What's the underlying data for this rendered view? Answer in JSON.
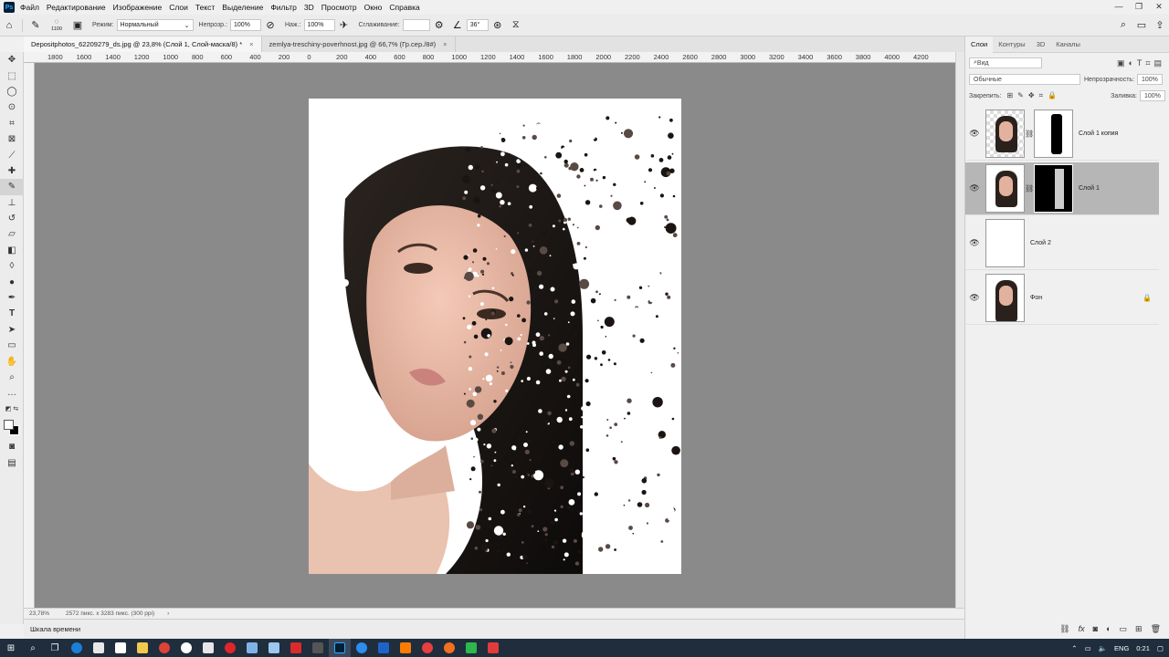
{
  "menu": {
    "items": [
      "Файл",
      "Редактирование",
      "Изображение",
      "Слои",
      "Текст",
      "Выделение",
      "Фильтр",
      "3D",
      "Просмотр",
      "Окно",
      "Справка"
    ]
  },
  "options": {
    "brush_size": "1100",
    "mode_label": "Режим:",
    "mode_value": "Нормальный",
    "opacity_label": "Непрозр.:",
    "opacity_value": "100%",
    "flow_label": "Наж.:",
    "flow_value": "100%",
    "smoothing_label": "Сглаживание:",
    "smoothing_value": "",
    "angle_value": "36°"
  },
  "tabs": [
    {
      "label": "Depositphotos_62209279_ds.jpg @ 23,8% (Слой 1, Слой-маска/8) *",
      "close": "×"
    },
    {
      "label": "zemlya-treschiny-poverhnost.jpg @ 66,7% (Гр.сер./8#)",
      "close": "×"
    }
  ],
  "ruler": {
    "h": [
      "1800",
      "1600",
      "1400",
      "1200",
      "1000",
      "800",
      "600",
      "400",
      "200",
      "0",
      "200",
      "400",
      "600",
      "800",
      "1000",
      "1200",
      "1400",
      "1600",
      "1800",
      "2000",
      "2200",
      "2400",
      "2600",
      "2800",
      "3000",
      "3200",
      "3400",
      "3600",
      "3800",
      "4000",
      "4200"
    ]
  },
  "status": {
    "zoom": "23,78%",
    "doc_info": "2572 пикс. x 3283 пикс. (300 ppi)",
    "arrow": "›"
  },
  "timeline": {
    "label": "Шкала времени"
  },
  "panel": {
    "tabs": [
      "Слои",
      "Контуры",
      "3D",
      "Каналы"
    ],
    "filter_value": "Вид",
    "blend_value": "Обычные",
    "opacity_label": "Непрозрачность:",
    "opacity_value": "100%",
    "lock_label": "Закрепить:",
    "fill_label": "Заливка:",
    "fill_value": "100%",
    "layers": [
      {
        "name": "Слой 1 копия"
      },
      {
        "name": "Слой 1"
      },
      {
        "name": "Слой 2"
      },
      {
        "name": "Фон"
      }
    ]
  },
  "taskbar": {
    "lang": "ENG",
    "time": "0:21"
  },
  "colors": {
    "canvas": "#8a8a8a",
    "active_layer": "#b6b6b6",
    "taskbar": "#1f2d3d"
  }
}
